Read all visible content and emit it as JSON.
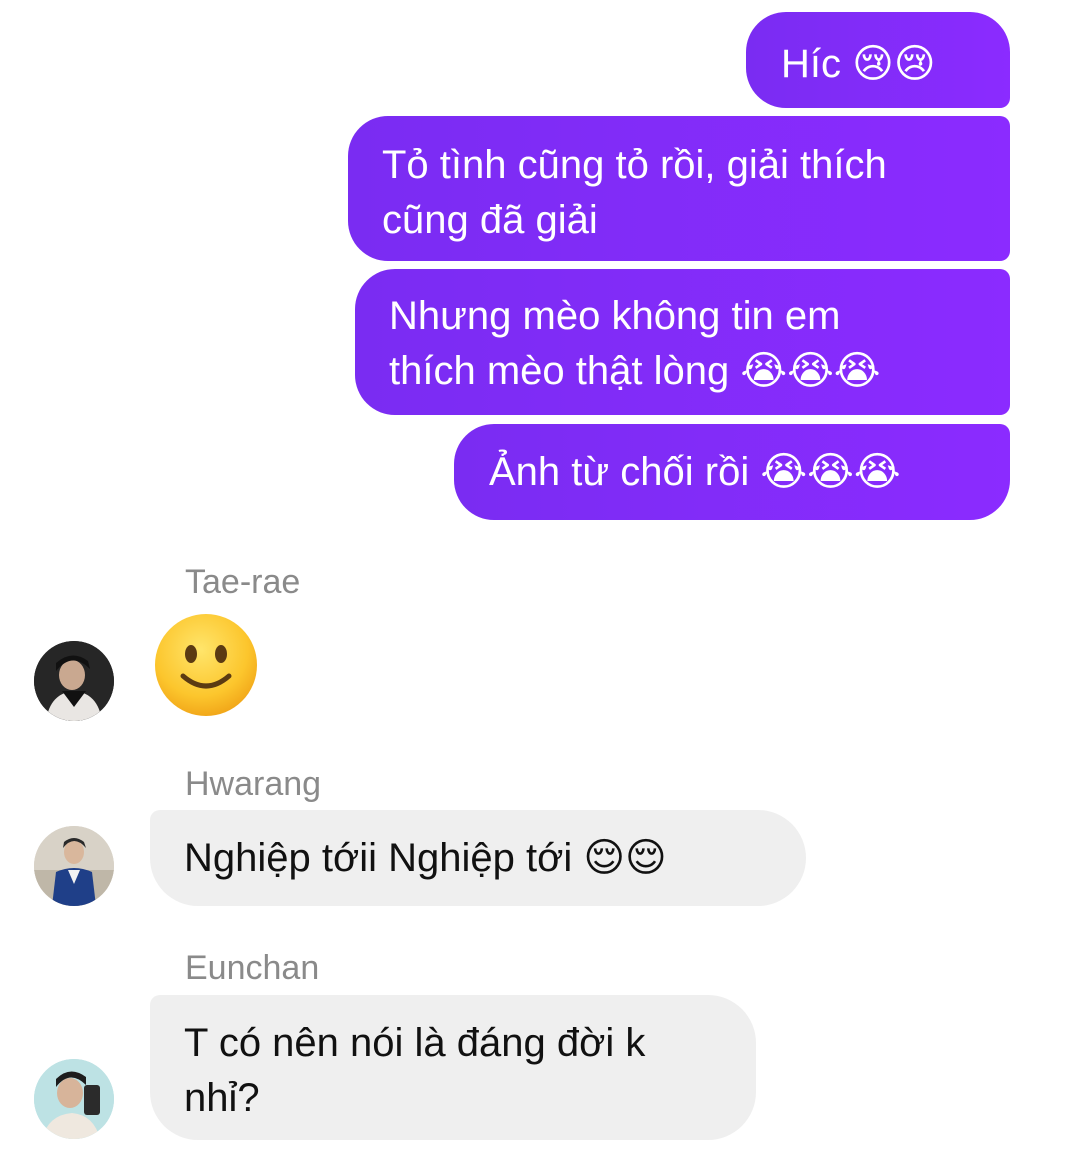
{
  "outgoing": [
    "Híc 😢😢",
    "Tỏ tình cũng tỏ rồi, giải thích\ncũng đã giải",
    "Nhưng mèo không tin em\nthích mèo thật lòng 😭😭😭",
    "Ảnh từ chối rồi 😭😭😭"
  ],
  "incoming": [
    {
      "sender": "Tae-rae",
      "avatar_icon": "profile-photo",
      "emoji": "slightly-smiling-face-icon"
    },
    {
      "sender": "Hwarang",
      "avatar_icon": "profile-photo",
      "text": "Nghiệp tớii Nghiệp tới 😌😌"
    },
    {
      "sender": "Eunchan",
      "avatar_icon": "profile-photo",
      "text": "T có nên nói là đáng đời k\nnhỉ?"
    }
  ],
  "colors": {
    "outgoing_bubble": "#8b2bff",
    "incoming_bubble": "#efefef",
    "sender_name": "#8a8a8a"
  }
}
